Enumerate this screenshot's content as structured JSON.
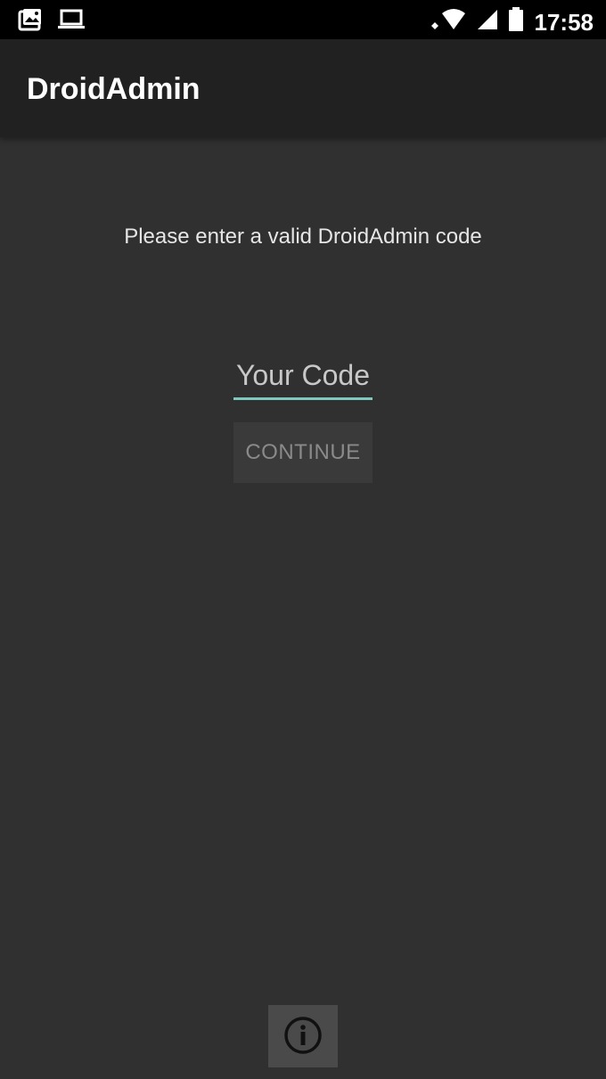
{
  "status_bar": {
    "time": "17:58",
    "left_icons": [
      "gallery-notification-icon",
      "laptop-notification-icon"
    ],
    "right_icons": [
      "wifi-icon",
      "signal-icon",
      "battery-icon"
    ]
  },
  "app_bar": {
    "title": "DroidAdmin"
  },
  "main": {
    "prompt": "Please enter a valid DroidAdmin code",
    "code_input": {
      "placeholder": "Your Code",
      "value": ""
    },
    "continue_label": "CONTINUE",
    "info_icon": "info-icon"
  },
  "colors": {
    "background": "#303030",
    "app_bar": "#212121",
    "status_bar": "#000000",
    "input_underline": "#7ec8be",
    "button_bg": "#3a3a3a",
    "button_text": "#8a8a8a"
  }
}
